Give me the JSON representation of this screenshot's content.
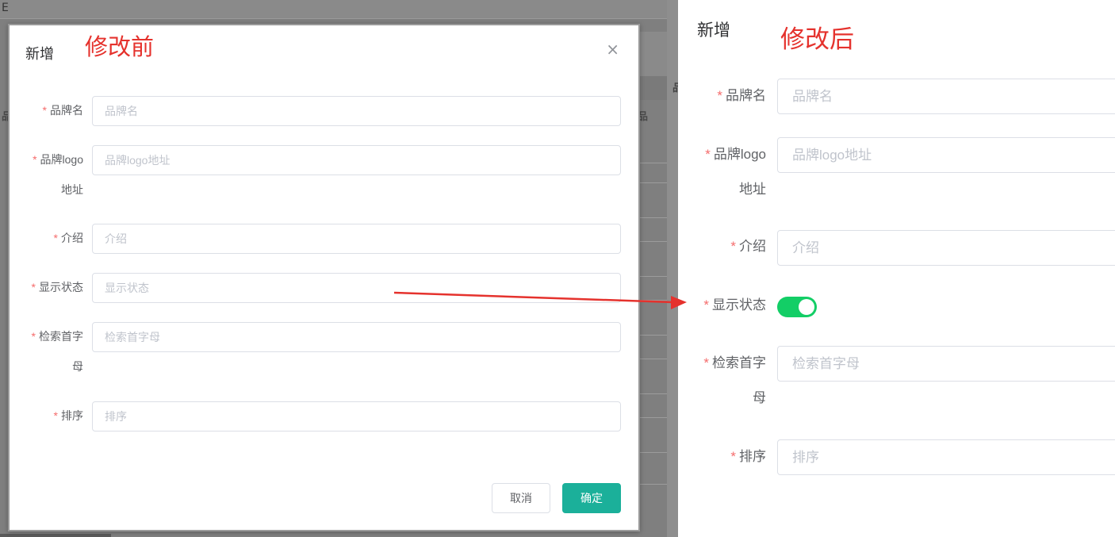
{
  "background": {
    "corner_fragment": "E",
    "side_fragment_1": "品",
    "side_fragment_2": "品"
  },
  "before": {
    "annotation": "修改前",
    "title": "新增",
    "close_glyph": "×",
    "fields": [
      {
        "label": "品牌名",
        "placeholder": "品牌名"
      },
      {
        "label_line1": "品牌logo",
        "label_line2": "地址",
        "placeholder": "品牌logo地址"
      },
      {
        "label": "介绍",
        "placeholder": "介绍"
      },
      {
        "label": "显示状态",
        "placeholder": "显示状态"
      },
      {
        "label_line1": "检索首字",
        "label_line2": "母",
        "placeholder": "检索首字母"
      },
      {
        "label": "排序",
        "placeholder": "排序"
      }
    ],
    "required_mark": "*",
    "cancel_label": "取消",
    "ok_label": "确定"
  },
  "after": {
    "annotation": "修改后",
    "title": "新增",
    "fields": [
      {
        "label": "品牌名",
        "placeholder": "品牌名"
      },
      {
        "label_line1": "品牌logo",
        "label_line2": "地址",
        "placeholder": "品牌logo地址"
      },
      {
        "label": "介绍",
        "placeholder": "介绍"
      },
      {
        "label": "显示状态",
        "switch_on": true
      },
      {
        "label_line1": "检索首字",
        "label_line2": "母",
        "placeholder": "检索首字母"
      },
      {
        "label": "排序",
        "placeholder": "排序"
      }
    ],
    "required_mark": "*"
  },
  "colors": {
    "annotation_red": "#e5322d",
    "primary_teal": "#1bb09a",
    "switch_green": "#13ce66",
    "required_star": "#f56c6c"
  }
}
